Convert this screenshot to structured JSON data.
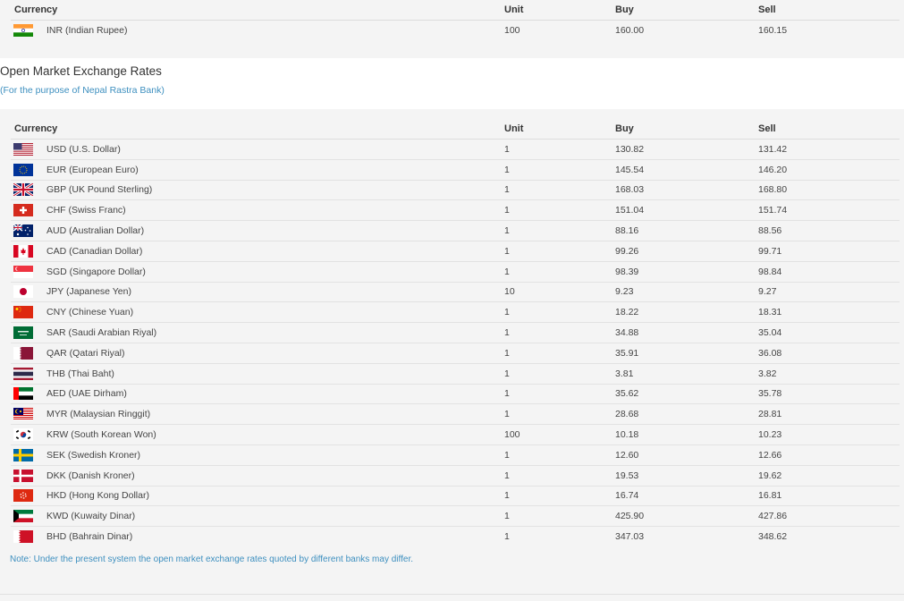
{
  "top_table": {
    "headers": [
      "Currency",
      "Unit",
      "Buy",
      "Sell"
    ],
    "rows": [
      {
        "flag": "india-flag-icon",
        "currency": "INR (Indian Rupee)",
        "unit": "100",
        "buy": "160.00",
        "sell": "160.15"
      }
    ]
  },
  "open_market": {
    "title": "Open Market Exchange Rates",
    "subtitle": "(For the purpose of Nepal Rastra Bank)",
    "headers": [
      "Currency",
      "Unit",
      "Buy",
      "Sell"
    ],
    "rows": [
      {
        "flag": "usa-flag-icon",
        "currency": "USD (U.S. Dollar)",
        "unit": "1",
        "buy": "130.82",
        "sell": "131.42"
      },
      {
        "flag": "eu-flag-icon",
        "currency": "EUR (European Euro)",
        "unit": "1",
        "buy": "145.54",
        "sell": "146.20"
      },
      {
        "flag": "uk-flag-icon",
        "currency": "GBP (UK Pound Sterling)",
        "unit": "1",
        "buy": "168.03",
        "sell": "168.80"
      },
      {
        "flag": "swiss-flag-icon",
        "currency": "CHF (Swiss Franc)",
        "unit": "1",
        "buy": "151.04",
        "sell": "151.74"
      },
      {
        "flag": "australia-flag-icon",
        "currency": "AUD (Australian Dollar)",
        "unit": "1",
        "buy": "88.16",
        "sell": "88.56"
      },
      {
        "flag": "canada-flag-icon",
        "currency": "CAD (Canadian Dollar)",
        "unit": "1",
        "buy": "99.26",
        "sell": "99.71"
      },
      {
        "flag": "singapore-flag-icon",
        "currency": "SGD (Singapore Dollar)",
        "unit": "1",
        "buy": "98.39",
        "sell": "98.84"
      },
      {
        "flag": "japan-flag-icon",
        "currency": "JPY (Japanese Yen)",
        "unit": "10",
        "buy": "9.23",
        "sell": "9.27"
      },
      {
        "flag": "china-flag-icon",
        "currency": "CNY (Chinese Yuan)",
        "unit": "1",
        "buy": "18.22",
        "sell": "18.31"
      },
      {
        "flag": "saudi-flag-icon",
        "currency": "SAR (Saudi Arabian Riyal)",
        "unit": "1",
        "buy": "34.88",
        "sell": "35.04"
      },
      {
        "flag": "qatar-flag-icon",
        "currency": "QAR (Qatari Riyal)",
        "unit": "1",
        "buy": "35.91",
        "sell": "36.08"
      },
      {
        "flag": "thailand-flag-icon",
        "currency": "THB (Thai Baht)",
        "unit": "1",
        "buy": "3.81",
        "sell": "3.82"
      },
      {
        "flag": "uae-flag-icon",
        "currency": "AED (UAE Dirham)",
        "unit": "1",
        "buy": "35.62",
        "sell": "35.78"
      },
      {
        "flag": "malaysia-flag-icon",
        "currency": "MYR (Malaysian Ringgit)",
        "unit": "1",
        "buy": "28.68",
        "sell": "28.81"
      },
      {
        "flag": "south-korea-flag-icon",
        "currency": "KRW (South Korean Won)",
        "unit": "100",
        "buy": "10.18",
        "sell": "10.23"
      },
      {
        "flag": "sweden-flag-icon",
        "currency": "SEK (Swedish Kroner)",
        "unit": "1",
        "buy": "12.60",
        "sell": "12.66"
      },
      {
        "flag": "denmark-flag-icon",
        "currency": "DKK (Danish Kroner)",
        "unit": "1",
        "buy": "19.53",
        "sell": "19.62"
      },
      {
        "flag": "hong-kong-flag-icon",
        "currency": "HKD (Hong Kong Dollar)",
        "unit": "1",
        "buy": "16.74",
        "sell": "16.81"
      },
      {
        "flag": "kuwait-flag-icon",
        "currency": "KWD (Kuwaity Dinar)",
        "unit": "1",
        "buy": "425.90",
        "sell": "427.86"
      },
      {
        "flag": "bahrain-flag-icon",
        "currency": "BHD (Bahrain Dinar)",
        "unit": "1",
        "buy": "347.03",
        "sell": "348.62"
      }
    ],
    "note": "Note: Under the present system the open market exchange rates quoted by different banks may differ."
  }
}
